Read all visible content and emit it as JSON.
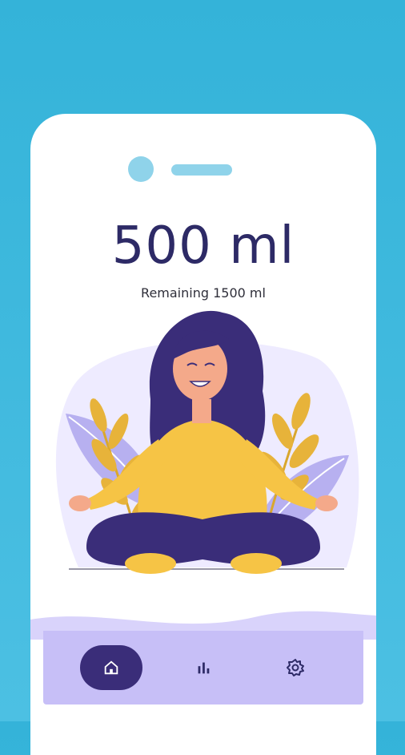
{
  "status": {
    "amount_label": "500 ml",
    "remaining_label": "Remaining 1500 ml"
  },
  "illustration": {
    "subject": "woman meditating in lotus pose with leaves"
  },
  "colors": {
    "background": "#4cc0e3",
    "card": "#ffffff",
    "accent_dark": "#2d2a66",
    "nav_background": "#c7bff7",
    "nav_active": "#3a2d79",
    "shirt": "#f6c445",
    "leaf_purple": "#b7b0f0",
    "leaf_gold": "#e7b33a"
  },
  "bottom_nav": {
    "items": [
      {
        "icon": "home-icon",
        "active": true
      },
      {
        "icon": "bar-chart-icon",
        "active": false
      },
      {
        "icon": "gear-icon",
        "active": false
      }
    ]
  }
}
